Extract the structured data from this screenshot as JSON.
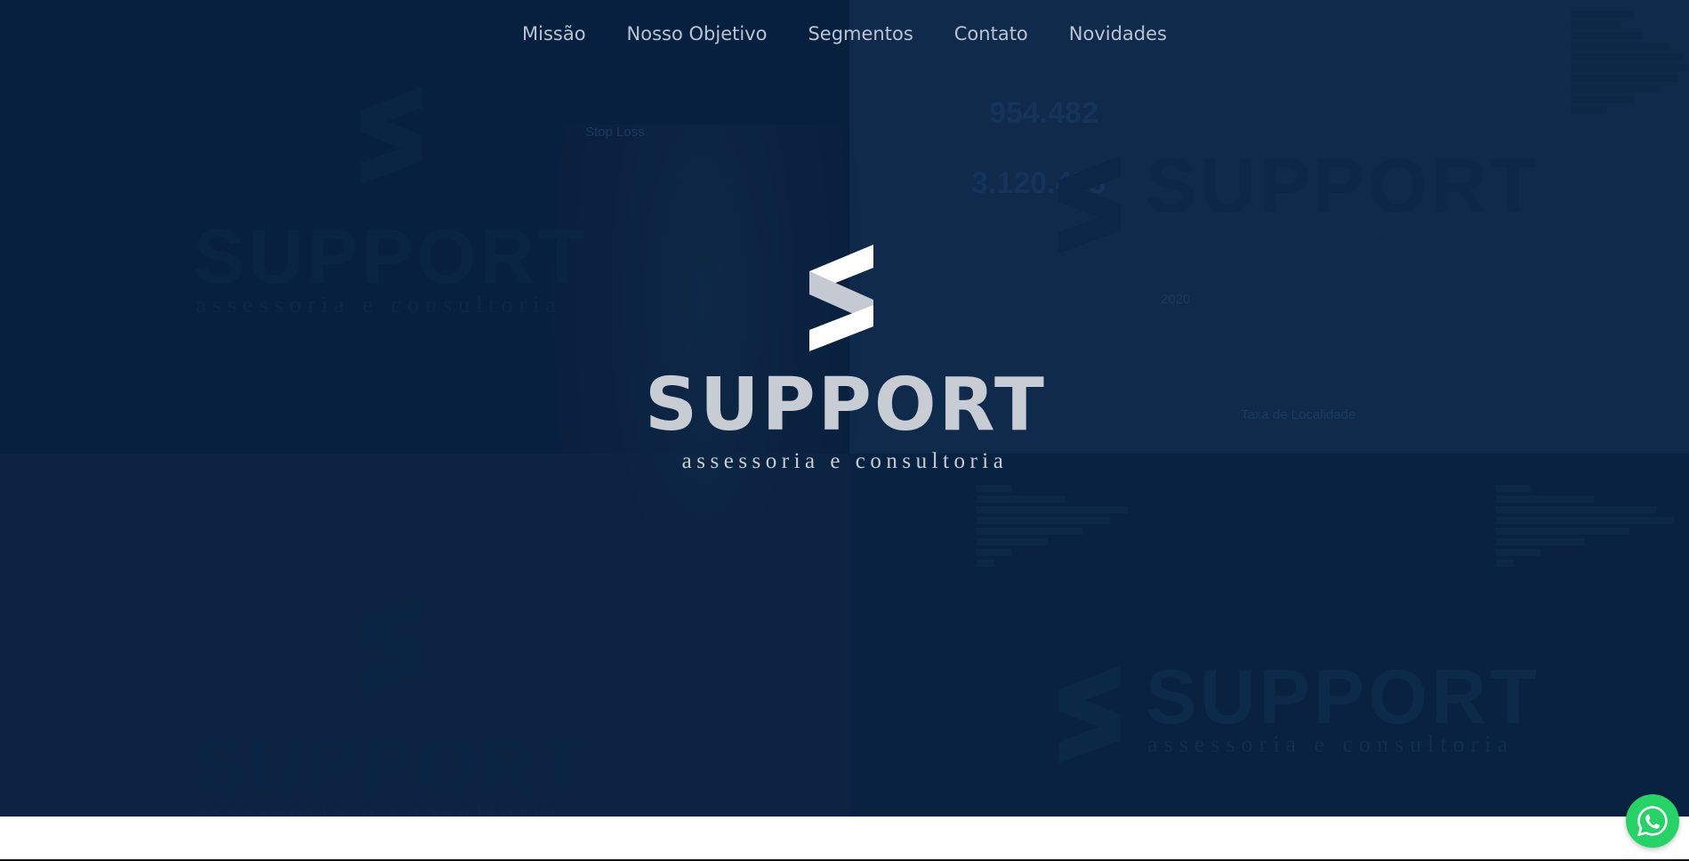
{
  "nav": {
    "items": [
      {
        "label": "Missão"
      },
      {
        "label": "Nosso Objetivo"
      },
      {
        "label": "Segmentos"
      },
      {
        "label": "Contato"
      },
      {
        "label": "Novidades"
      }
    ]
  },
  "hero": {
    "brand": "SUPPORT",
    "tagline": "assessoria e consultoria"
  },
  "background_dashboard": {
    "stats": [
      "Stop Loss",
      "954.482",
      "3.120.453",
      "2020",
      "Taxa de Localidade"
    ]
  },
  "whatsapp": {
    "icon": "whatsapp-icon",
    "color": "#25d366"
  },
  "colors": {
    "hero_bg": "#0b2240",
    "nav_text": "#b9c4d2",
    "logo": "#c8ccd3"
  }
}
